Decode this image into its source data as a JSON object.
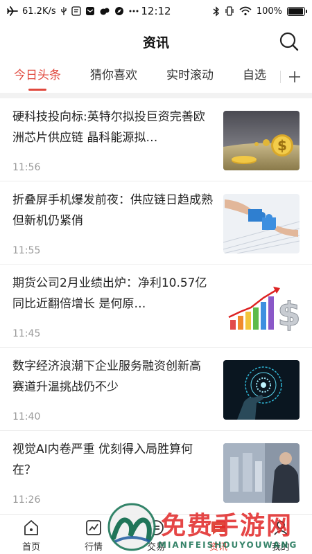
{
  "status_bar": {
    "net_speed": "61.2K/s",
    "time": "12:12",
    "battery_text": "100%",
    "battery_level": 1.0
  },
  "header": {
    "title": "资讯"
  },
  "tabs": [
    {
      "label": "今日头条",
      "active": true
    },
    {
      "label": "猜你喜欢",
      "active": false
    },
    {
      "label": "实时滚动",
      "active": false
    },
    {
      "label": "自选",
      "active": false
    }
  ],
  "news": [
    {
      "title": "硬科技投向标:英特尔拟投巨资完善欧洲芯片供应链 晶科能源拟…",
      "time": "11:56",
      "thumb": "coins"
    },
    {
      "title": "折叠屏手机爆发前夜：供应链日趋成熟 但新机仍紧俏",
      "time": "11:55",
      "thumb": "puzzle"
    },
    {
      "title": "期货公司2月业绩出炉：净利10.57亿同比近翻倍增长 是何原…",
      "time": "11:45",
      "thumb": "bars-dollar"
    },
    {
      "title": "数字经济浪潮下企业服务融资创新高 赛道升温挑战仍不少",
      "time": "11:40",
      "thumb": "digital-hand"
    },
    {
      "title": "视觉AI内卷严重 优刻得入局胜算何在？",
      "time": "11:26",
      "thumb": "businessman"
    }
  ],
  "bottom_nav": [
    {
      "label": "首页",
      "icon": "home-icon",
      "active": false
    },
    {
      "label": "行情",
      "icon": "chart-icon",
      "active": false
    },
    {
      "label": "交易",
      "icon": "trade-icon",
      "active": false
    },
    {
      "label": "资讯",
      "icon": "news-icon",
      "active": true
    },
    {
      "label": "我的",
      "icon": "user-icon",
      "active": false
    }
  ],
  "watermark": {
    "text": "免费手游网",
    "sub": "MIANFEISHOUYOUWANG"
  },
  "colors": {
    "accent": "#e0483d",
    "text": "#222222",
    "muted": "#999999"
  }
}
